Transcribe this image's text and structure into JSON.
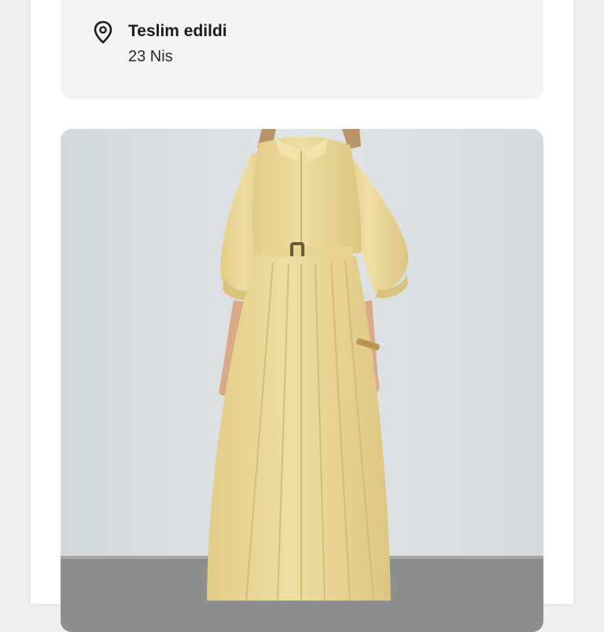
{
  "order_status": {
    "title": "Teslim edildi",
    "date": "23 Nis",
    "icon": "location-pin-icon"
  },
  "product": {
    "image": "product-photo-yellow-belted-dress",
    "colors": {
      "dress": "#ecd99a",
      "background": "#dde1e4",
      "floor": "#8e8e8e"
    }
  }
}
